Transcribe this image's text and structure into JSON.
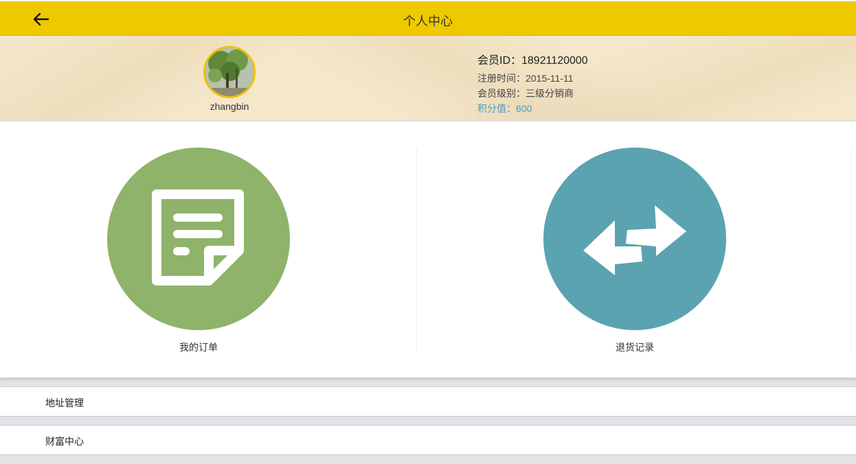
{
  "header": {
    "title": "个人中心",
    "back_icon": "arrow-left-icon"
  },
  "profile": {
    "username": "zhangbin",
    "member_id": "会员ID：18921120000",
    "register_date": "注册时间：2015-11-11",
    "member_level": "会员级别：三级分销商",
    "points": "积分值：600"
  },
  "tiles": [
    {
      "label": "我的订单",
      "icon": "order-document-icon",
      "color": "#8fb36a"
    },
    {
      "label": "退货记录",
      "icon": "swap-arrows-icon",
      "color": "#5ba3b1"
    }
  ],
  "menu": [
    {
      "label": "地址管理"
    },
    {
      "label": "财富中心"
    }
  ],
  "colors": {
    "header": "#eec900",
    "points_text": "#4f9ab5"
  }
}
